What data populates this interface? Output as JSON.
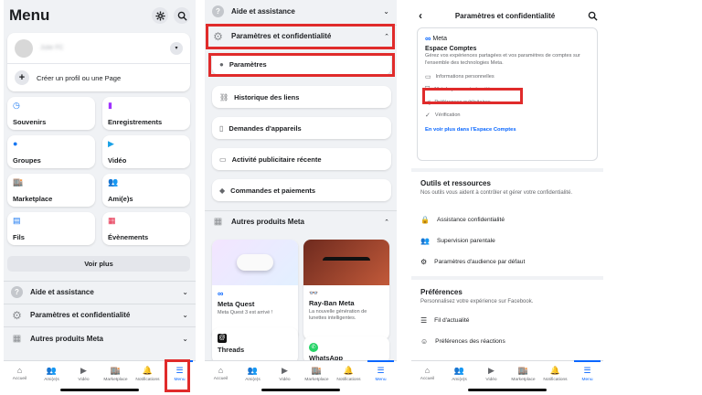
{
  "colors": {
    "accent": "#0866ff",
    "highlight": "#e02b2b"
  },
  "tabs": [
    {
      "label": "Accueil",
      "icon": "home-icon"
    },
    {
      "label": "Ami(e)s",
      "icon": "friends-icon"
    },
    {
      "label": "Vidéo",
      "icon": "video-icon"
    },
    {
      "label": "Marketplace",
      "icon": "marketplace-icon"
    },
    {
      "label": "Notifications",
      "icon": "bell-icon"
    },
    {
      "label": "Menu",
      "icon": "menu-icon"
    }
  ],
  "phone1": {
    "title": "Menu",
    "profile_name": "Julie FC",
    "create_profile": "Créer un profil ou une Page",
    "shortcuts": [
      {
        "label": "Souvenirs",
        "icon": "clock-icon",
        "color": "#1877f2"
      },
      {
        "label": "Enregistrements",
        "icon": "bookmark-icon",
        "color": "#a033ff"
      },
      {
        "label": "Groupes",
        "icon": "groups-icon",
        "color": "#1877f2"
      },
      {
        "label": "Vidéo",
        "icon": "video-icon",
        "color": "#1aa1e6"
      },
      {
        "label": "Marketplace",
        "icon": "marketplace-icon",
        "color": "#1877f2"
      },
      {
        "label": "Ami(e)s",
        "icon": "friends-icon",
        "color": "#1877f2"
      },
      {
        "label": "Fils",
        "icon": "feeds-icon",
        "color": "#1877f2"
      },
      {
        "label": "Évènements",
        "icon": "calendar-icon",
        "color": "#e41e3f"
      }
    ],
    "see_more": "Voir plus",
    "sections": [
      "Aide et assistance",
      "Paramètres et confidentialité",
      "Autres produits Meta"
    ]
  },
  "phone2": {
    "help": "Aide et assistance",
    "settings_privacy": "Paramètres et confidentialité",
    "items": [
      {
        "label": "Paramètres",
        "icon": "user-icon"
      },
      {
        "label": "Historique des liens",
        "icon": "link-icon"
      },
      {
        "label": "Demandes d'appareils",
        "icon": "device-icon"
      },
      {
        "label": "Activité publicitaire récente",
        "icon": "ad-icon"
      },
      {
        "label": "Commandes et paiements",
        "icon": "tag-icon"
      }
    ],
    "other_products": "Autres produits Meta",
    "products": [
      {
        "title": "Meta Quest",
        "desc": "Meta Quest 3 est arrivé !"
      },
      {
        "title": "Ray-Ban Meta",
        "desc": "La nouvelle génération de lunettes intelligentes."
      },
      {
        "title": "Threads",
        "desc": ""
      },
      {
        "title": "WhatsApp",
        "desc": ""
      }
    ]
  },
  "phone3": {
    "title": "Paramètres et confidentialité",
    "meta_logo": "Meta",
    "accounts_center": "Espace Comptes",
    "accounts_desc": "Gérez vos expériences partagées et vos paramètres de comptes sur l'ensemble des technologies Meta.",
    "accounts_items": [
      {
        "label": "Informations personnelles",
        "icon": "id-card-icon"
      },
      {
        "label": "Mot de passe et sécurité",
        "icon": "shield-icon"
      },
      {
        "label": "Préférences publicitaires",
        "icon": "megaphone-icon"
      },
      {
        "label": "Vérification",
        "icon": "check-badge-icon"
      }
    ],
    "accounts_link": "En voir plus dans l'Espace Comptes",
    "tools_title": "Outils et ressources",
    "tools_desc": "Nos outils vous aident à contrôler et gérer votre confidentialité.",
    "tools_items": [
      {
        "label": "Assistance confidentialité",
        "icon": "lock-icon"
      },
      {
        "label": "Supervision parentale",
        "icon": "people-icon"
      },
      {
        "label": "Paramètres d'audience par défaut",
        "icon": "gear-icon"
      }
    ],
    "prefs_title": "Préférences",
    "prefs_desc": "Personnalisez votre expérience sur Facebook.",
    "prefs_items": [
      {
        "label": "Fil d'actualité",
        "icon": "sliders-icon"
      },
      {
        "label": "Préférences des réactions",
        "icon": "reaction-icon"
      }
    ]
  }
}
